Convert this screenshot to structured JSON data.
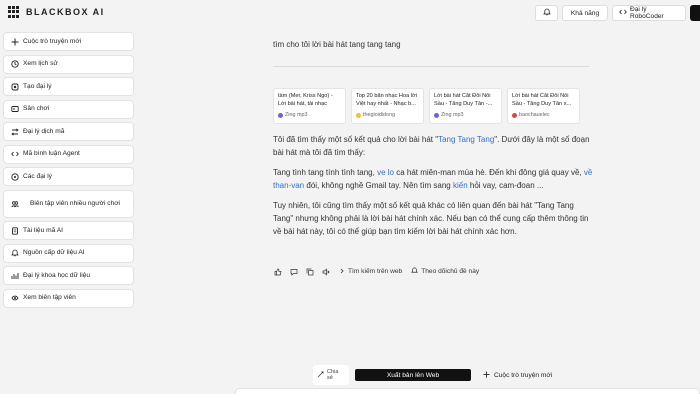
{
  "app": {
    "logo_text": "BLACKBOX AI"
  },
  "sidebar": {
    "items": [
      {
        "label": "Cuộc trò truyện mới",
        "icon": "plus-icon"
      },
      {
        "label": "Xem lịch sử",
        "icon": "history-icon"
      },
      {
        "label": "Tạo đại lý",
        "icon": "agent-create-icon"
      },
      {
        "label": "Sân chơi",
        "icon": "playground-icon"
      },
      {
        "label": "Đại lý dịch mã",
        "icon": "translate-code-icon"
      },
      {
        "label": "Mã bình luận Agent",
        "icon": "code-review-icon"
      },
      {
        "label": "Các đại lý",
        "icon": "agents-icon"
      },
      {
        "label": "Biên tập viên nhiều người chơi",
        "icon": "multiplayer-editor-icon"
      },
      {
        "label": "Tài liệu mã AI",
        "icon": "docs-icon"
      },
      {
        "label": "Nguồn cấp dữ liệu AI",
        "icon": "feed-icon"
      },
      {
        "label": "Đại lý khoa học dữ liệu",
        "icon": "data-science-icon"
      },
      {
        "label": "Xem biên tập viên",
        "icon": "editor-view-icon"
      }
    ]
  },
  "topbar": {
    "bell_icon": "bell-icon",
    "capability_label": "Khả năng",
    "robocoder_label": "Đại lý RoboCoder"
  },
  "chat": {
    "query": "tìm cho tôi lời bài hát tang tang tang",
    "sources": [
      {
        "title": "tàm (Mer, Kriss Ngo) - Lời bài hát, tải nhạc Zin...",
        "site": "Zing mp3"
      },
      {
        "title": "Top 20 bản nhạc Hoa lời Việt hay nhất - Nhạc b...",
        "site": "thegioididong"
      },
      {
        "title": "Lời bài hát Cắt Đôi Nỗi Sầu - Tăng Duy Tân -...",
        "site": "Zing mp3"
      },
      {
        "title": "Lời bài hát Cắt Đôi Nỗi Sầu - Tăng Duy Tân x...",
        "site": "baochauelec"
      }
    ],
    "p1_a": "Tôi đã tìm thấy một số kết quả cho lời bài hát \"",
    "p1_link": "Tang Tang Tang",
    "p1_b": "\". Dưới đây là một số đoạn bài hát mà tôi đã tìm thấy:",
    "p2_a": "Tang tình tang tính tình tang, ",
    "p2_link1": "ve lo",
    "p2_b": " ca hát miên-man mùa hè. Đến khi đông giá quay về, ",
    "p2_link2": "về than-van",
    "p2_c": " đói, không nghề Gmail tay. Nên tìm sang ",
    "p2_link3": "kiến",
    "p2_d": " hỏi vay, cam-đoan ...",
    "p3": "Tuy nhiên, tôi cũng tìm thấy một số kết quả khác có liên quan đến bài hát \"Tang Tang Tang\" nhưng không phải là lời bài hát chính xác. Nếu bạn có thể cung cấp thêm thông tin về bài hát này, tôi có thể giúp bạn tìm kiếm lời bài hát chính xác hơn.",
    "actions": {
      "search_web": "Tìm kiếm trên web",
      "follow": "Theo dõichủ đề này"
    }
  },
  "bottom": {
    "share_label": "Chia sẻ",
    "publish_label": "Xuất bản lên Web",
    "new_chat_label": "Cuộc trò truyện mới"
  }
}
